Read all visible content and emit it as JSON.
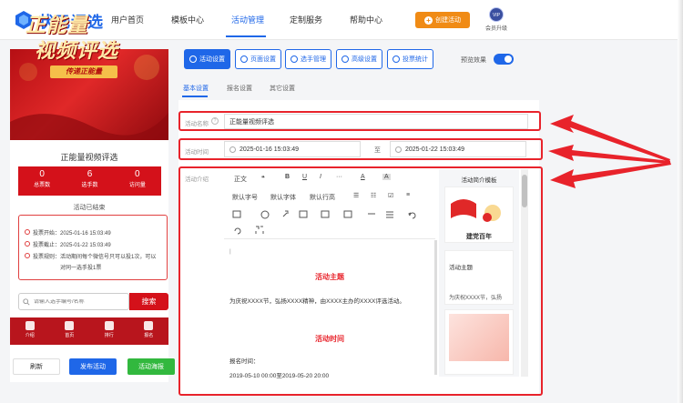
{
  "brand": {
    "name": "状元评选",
    "primary": "#1f67e8",
    "accent": "#f08b15",
    "red": "#d4111a"
  },
  "nav": {
    "items": [
      "用户首页",
      "模板中心",
      "活动管理",
      "定制服务",
      "帮助中心"
    ],
    "active": "活动管理"
  },
  "header": {
    "create_label": "创建活动",
    "vip_badge": "VIP",
    "vip_label": "会员升级"
  },
  "preview": {
    "banner_line1": "正能量",
    "banner_line2": "视频评选",
    "banner_ribbon": "传递正能量",
    "title": "正能量视频评选",
    "stats": [
      {
        "value": "0",
        "label": "总票数"
      },
      {
        "value": "6",
        "label": "选手数"
      },
      {
        "value": "0",
        "label": "访问量"
      }
    ],
    "status": "活动已结束",
    "info": [
      "投票开始：2025-01-16 15:03:49",
      "投票截止：2025-01-22 15:03:49",
      "投票规则：活动期间每个微信号只可以投1次，可以",
      "对同一选手投1票"
    ],
    "search_placeholder": "请输入选手编号/名称",
    "search_button": "搜索",
    "bottom_nav": [
      "介绍",
      "首页",
      "排行",
      "报名"
    ]
  },
  "actions": {
    "refresh": "刷新",
    "publish": "发布活动",
    "poster": "活动海报"
  },
  "tabs": [
    "活动设置",
    "页面设置",
    "选手管理",
    "高级设置",
    "投票统计"
  ],
  "preview_toggle_label": "预览效果",
  "subtabs": [
    "基本设置",
    "报名设置",
    "其它设置"
  ],
  "form": {
    "name_label": "活动名称",
    "name_value": "正能量视频评选",
    "time_label": "活动时间",
    "time_start": "2025-01-16 15:03:49",
    "time_to": "至",
    "time_end": "2025-01-22 15:03:49",
    "intro_label": "活动介绍"
  },
  "editor": {
    "toolbar_row1": [
      "正文",
      "❝",
      "B",
      "U",
      "I",
      "···",
      "A",
      "A"
    ],
    "toolbar_row2": [
      "默认字号",
      "默认字体",
      "默认行高",
      "☰",
      "☷",
      "☑",
      "≡"
    ],
    "heading1": "活动主题",
    "para1": "为庆祝XXXX节，弘扬XXXX精神，由XXXX主办的XXXX评选活动。",
    "heading2": "活动时间",
    "para2_label": "报名时间：",
    "para2_value": "2019-05-10 00:00至2019-05-20 20:00"
  },
  "templates": {
    "title": "活动简介模板",
    "card1_text": "建党百年",
    "card2_text": "活动主题",
    "card2_sub": "为庆祝XXXX节，弘扬"
  }
}
